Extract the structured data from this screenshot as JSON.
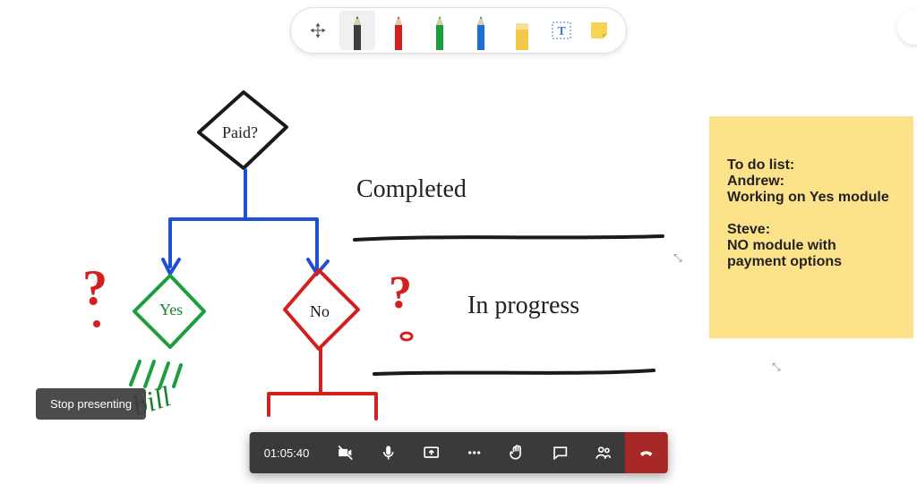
{
  "toolbar": {
    "tools": {
      "move": "move-canvas",
      "pen_black": "pen-black",
      "pen_red": "pen-red",
      "pen_green": "pen-green",
      "pen_blue": "pen-blue",
      "eraser": "eraser",
      "text": "text-box",
      "note": "sticky-note"
    },
    "pen_colors": {
      "black": "#2b2b2b",
      "red": "#d41f1f",
      "green": "#1a9e3e",
      "blue": "#1f6fd4"
    }
  },
  "flowchart": {
    "paid_label": "Paid?",
    "yes_label": "Yes",
    "no_label": "No",
    "completed_label": "Completed",
    "inprogress_label": "In progress",
    "bill_label": "bill",
    "question_mark": "?"
  },
  "sticky_note": {
    "text": "To do list:\nAndrew:\nWorking on Yes module\n\nSteve:\nNO module with payment options"
  },
  "presenting": {
    "stop_label": "Stop presenting"
  },
  "meeting_bar": {
    "timer": "01:05:40",
    "items": {
      "camera": "camera-off",
      "mic": "microphone",
      "share": "share-screen",
      "more": "more-actions",
      "raise_hand": "raise-hand",
      "chat": "show-conversation",
      "participants": "show-participants",
      "hangup": "hang-up"
    }
  },
  "colors": {
    "note_bg": "#fce38a",
    "hangup_bg": "#a82828",
    "bar_bg": "#3a3a3a"
  }
}
